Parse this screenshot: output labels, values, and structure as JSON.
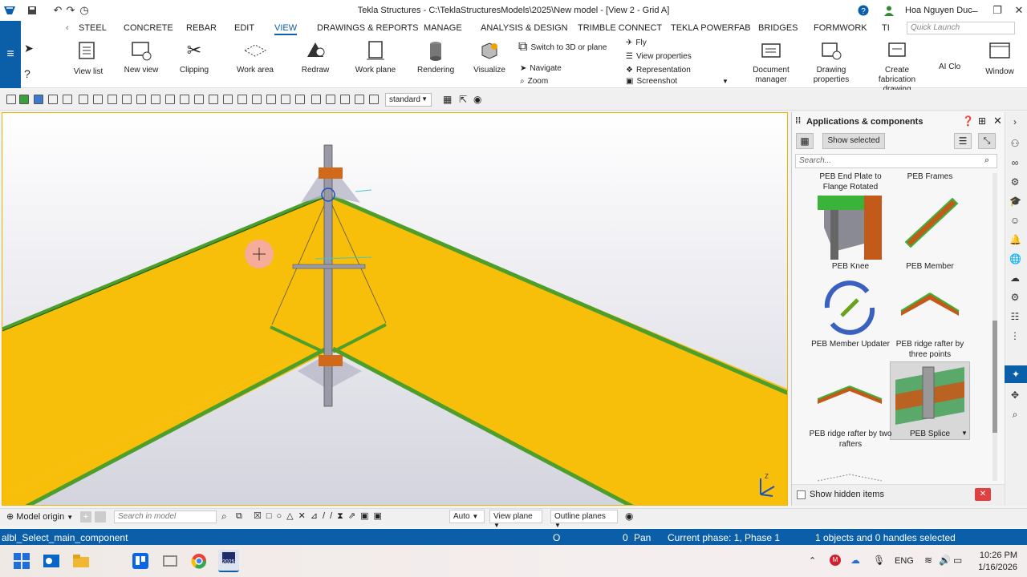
{
  "window": {
    "title": "Tekla Structures - C:\\TeklaStructuresModels\\2025\\New model - [View 2 - Grid A]",
    "user": "Hoa Nguyen Duc"
  },
  "menu": {
    "items": [
      "STEEL",
      "CONCRETE",
      "REBAR",
      "EDIT",
      "VIEW",
      "DRAWINGS & REPORTS",
      "MANAGE",
      "ANALYSIS & DESIGN",
      "TRIMBLE CONNECT",
      "TEKLA POWERFAB",
      "BRIDGES",
      "FORMWORK",
      "TI"
    ],
    "active": "VIEW",
    "quick_launch_placeholder": "Quick Launch"
  },
  "ribbon": {
    "view_list": "View list",
    "new_view": "New view",
    "clipping": "Clipping",
    "work_area": "Work area",
    "redraw": "Redraw",
    "work_plane": "Work plane",
    "rendering": "Rendering",
    "visualize": "Visualize",
    "switch_3d": "Switch to 3D or plane",
    "navigate": "Navigate",
    "zoom": "Zoom",
    "fly": "Fly",
    "view_properties": "View properties",
    "representation": "Representation",
    "screenshot": "Screenshot",
    "document_manager": "Document manager",
    "drawing_properties": "Drawing properties",
    "create_fabrication_drawing": "Create fabrication drawing",
    "ai_clo": "AI Clo",
    "window": "Window"
  },
  "toolbar": {
    "standard": "standard"
  },
  "panel": {
    "title": "Applications & components",
    "show_selected": "Show selected",
    "search_placeholder": "Search...",
    "components": [
      {
        "label": "PEB End Plate to Flange Rotated"
      },
      {
        "label": "PEB Frames"
      },
      {
        "label": "PEB Knee"
      },
      {
        "label": "PEB Member"
      },
      {
        "label": "PEB Member Updater"
      },
      {
        "label": "PEB ridge rafter by three points"
      },
      {
        "label": "PEB ridge rafter by two rafters"
      },
      {
        "label": "PEB Splice"
      }
    ],
    "show_hidden": "Show hidden items"
  },
  "bottombar": {
    "model_origin": "Model origin",
    "search_placeholder": "Search in model",
    "auto": "Auto",
    "view_plane": "View plane",
    "outline_planes": "Outline planes"
  },
  "status": {
    "command": "albl_Select_main_component",
    "o": "O",
    "pan_count": "0",
    "pan": "Pan",
    "phase": "Current phase: 1, Phase 1",
    "selection": "1 objects and 0 handles selected"
  },
  "taskbar": {
    "lang": "ENG",
    "time": "10:26 PM",
    "date": "1/16/2026",
    "tekla_badge": "2025"
  },
  "colors": {
    "accent": "#0b5ea8",
    "rafter": "#f7bf0a",
    "flange": "#4d9e2a"
  }
}
